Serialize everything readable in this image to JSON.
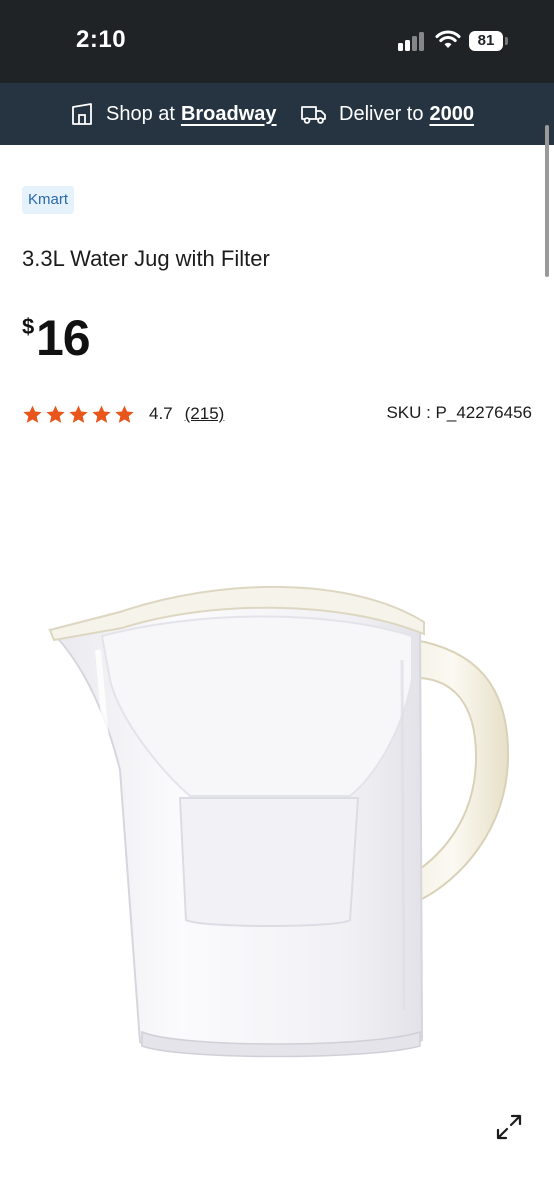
{
  "status_bar": {
    "time": "2:10",
    "battery": "81"
  },
  "store_bar": {
    "shop_label": "Shop at",
    "shop_value": "Broadway",
    "deliver_label": "Deliver to",
    "deliver_value": "2000"
  },
  "product": {
    "brand": "Kmart",
    "title": "3.3L Water Jug with Filter",
    "price_currency": "$",
    "price_amount": "16",
    "rating_value": "4.7",
    "rating_count": "(215)",
    "rating_stars": 5,
    "sku": "SKU : P_42276456"
  },
  "colors": {
    "status_bg": "#1f2326",
    "store_bar_bg": "#263442",
    "star": "#e8561c",
    "badge_bg": "#e5f1fb",
    "badge_text": "#2a6aa8"
  },
  "icons": {
    "store": "store-icon",
    "delivery": "delivery-truck-icon",
    "expand": "expand-icon"
  }
}
